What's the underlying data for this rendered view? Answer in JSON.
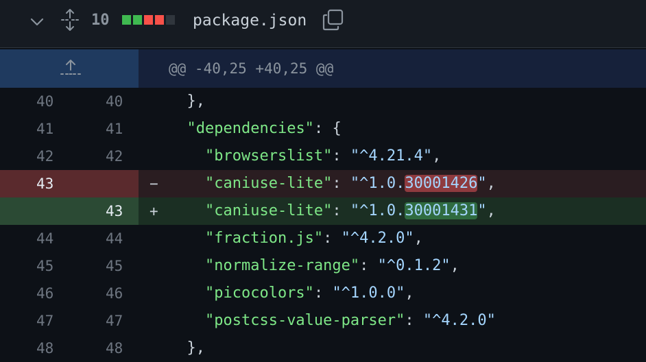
{
  "file": {
    "changes_count": "10",
    "name": "package.json",
    "diffstat": [
      "#3fb950",
      "#3fb950",
      "#f85149",
      "#f85149",
      "#30363d"
    ]
  },
  "hunk": {
    "header": "@@ -40,25 +40,25 @@"
  },
  "lines": [
    {
      "type": "ctx",
      "old": "40",
      "new": "40",
      "marker": "",
      "indent": "  ",
      "key": "",
      "sep": "",
      "pre": "",
      "hl": "",
      "post": "",
      "tail": "},"
    },
    {
      "type": "ctx",
      "old": "41",
      "new": "41",
      "marker": "",
      "indent": "  ",
      "key": "\"dependencies\"",
      "sep": ": ",
      "pre": "",
      "hl": "",
      "post": "",
      "tail": "{"
    },
    {
      "type": "ctx",
      "old": "42",
      "new": "42",
      "marker": "",
      "indent": "    ",
      "key": "\"browserslist\"",
      "sep": ": ",
      "pre": "\"^4.21.4\"",
      "hl": "",
      "post": "",
      "tail": ","
    },
    {
      "type": "del",
      "old": "43",
      "new": "",
      "marker": "−",
      "indent": "    ",
      "key": "\"caniuse-lite\"",
      "sep": ": ",
      "pre": "\"^1.0.",
      "hl": "30001426",
      "post": "\"",
      "tail": ","
    },
    {
      "type": "add",
      "old": "",
      "new": "43",
      "marker": "+",
      "indent": "    ",
      "key": "\"caniuse-lite\"",
      "sep": ": ",
      "pre": "\"^1.0.",
      "hl": "30001431",
      "post": "\"",
      "tail": ","
    },
    {
      "type": "ctx",
      "old": "44",
      "new": "44",
      "marker": "",
      "indent": "    ",
      "key": "\"fraction.js\"",
      "sep": ": ",
      "pre": "\"^4.2.0\"",
      "hl": "",
      "post": "",
      "tail": ","
    },
    {
      "type": "ctx",
      "old": "45",
      "new": "45",
      "marker": "",
      "indent": "    ",
      "key": "\"normalize-range\"",
      "sep": ": ",
      "pre": "\"^0.1.2\"",
      "hl": "",
      "post": "",
      "tail": ","
    },
    {
      "type": "ctx",
      "old": "46",
      "new": "46",
      "marker": "",
      "indent": "    ",
      "key": "\"picocolors\"",
      "sep": ": ",
      "pre": "\"^1.0.0\"",
      "hl": "",
      "post": "",
      "tail": ","
    },
    {
      "type": "ctx",
      "old": "47",
      "new": "47",
      "marker": "",
      "indent": "    ",
      "key": "\"postcss-value-parser\"",
      "sep": ": ",
      "pre": "\"^4.2.0\"",
      "hl": "",
      "post": "",
      "tail": ""
    },
    {
      "type": "ctx",
      "old": "48",
      "new": "48",
      "marker": "",
      "indent": "  ",
      "key": "",
      "sep": "",
      "pre": "",
      "hl": "",
      "post": "",
      "tail": "},"
    }
  ]
}
